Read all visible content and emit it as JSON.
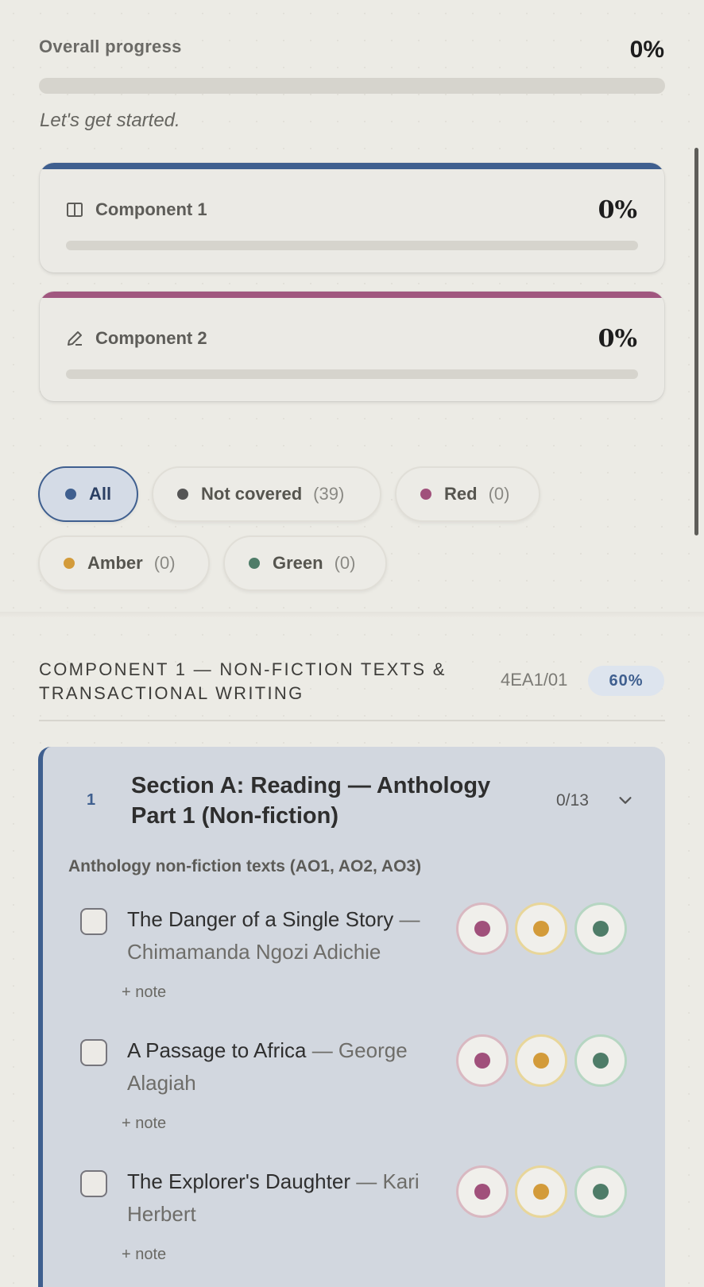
{
  "overall": {
    "label": "Overall progress",
    "percent_text": "0%",
    "progress": 0,
    "message": "Let's get started."
  },
  "components": [
    {
      "name": "Component 1",
      "percent_text": "0%",
      "progress": 0,
      "icon": "book-open-icon",
      "color": "#3f5f8f"
    },
    {
      "name": "Component 2",
      "percent_text": "0%",
      "progress": 0,
      "icon": "pencil-icon",
      "color": "#a0577f"
    }
  ],
  "filters": [
    {
      "label": "All",
      "count": "",
      "color": "#3f5f8f",
      "active": true
    },
    {
      "label": "Not covered",
      "count": "(39)",
      "color": "#555555"
    },
    {
      "label": "Red",
      "count": "(0)",
      "color": "#a0507b"
    },
    {
      "label": "Amber",
      "count": "(0)",
      "color": "#d39b3a"
    },
    {
      "label": "Green",
      "count": "(0)",
      "color": "#4e7c68"
    }
  ],
  "section": {
    "heading": "COMPONENT 1 — NON-FICTION TEXTS & TRANSACTIONAL WRITING",
    "code": "4EA1/01",
    "weight": "60%"
  },
  "section_card": {
    "number": "1",
    "title": "Section A: Reading — Anthology Part 1 (Non-fiction)",
    "count": "0/13",
    "group_label": "Anthology non-fiction texts (AO1, AO2, AO3)",
    "items": [
      {
        "title": "The Danger of a Single Story",
        "author": "— Chimamanda Ngozi Adichie",
        "note": "+ note"
      },
      {
        "title": "A Passage to Africa",
        "author": "— George Alagiah",
        "note": "+ note"
      },
      {
        "title": "The Explorer's Daughter",
        "author": "— Kari Herbert",
        "note": "+ note"
      }
    ]
  },
  "rag_colors": {
    "red": "#a0507b",
    "amber": "#d39b3a",
    "green": "#4e7c68"
  }
}
